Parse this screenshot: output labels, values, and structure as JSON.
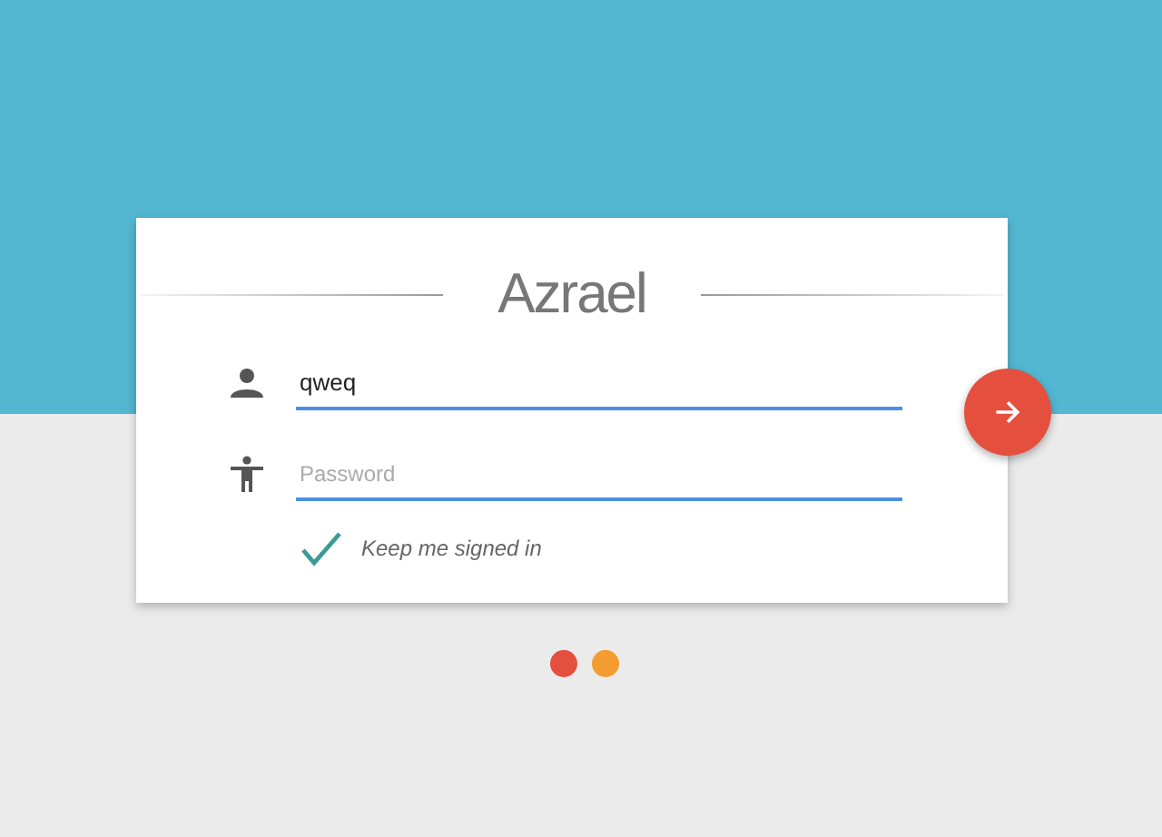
{
  "title": "Azrael",
  "fields": [
    {
      "kind": "user",
      "value": "qweq"
    },
    {
      "kind": "password",
      "placeholder": "Password"
    }
  ],
  "remember": {
    "label": "Keep me signed in",
    "checked": true
  },
  "dots": [
    {
      "color": "#e4503d"
    },
    {
      "color": "#f39c32"
    }
  ]
}
